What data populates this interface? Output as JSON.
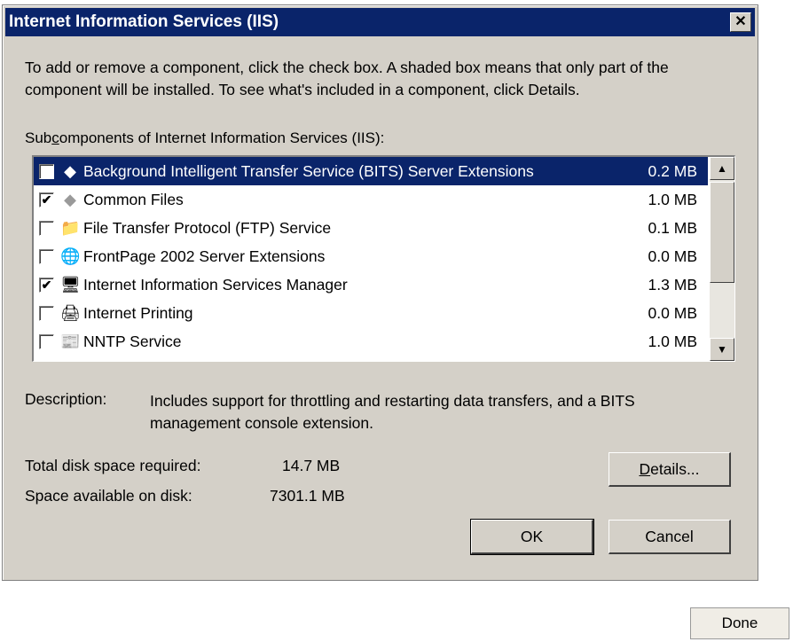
{
  "window": {
    "title": "Internet Information Services (IIS)",
    "close_label": "✕"
  },
  "intro_text": "To add or remove a component, click the check box. A shaded box means that only part of the component will be installed. To see what's included in a component, click Details.",
  "subcomponents_label": {
    "before": "Sub",
    "underlined": "c",
    "after": "omponents of Internet Information Services (IIS):"
  },
  "components": [
    {
      "name": "Background Intelligent Transfer Service (BITS) Server Extensions",
      "size": "0.2 MB",
      "checked": false,
      "selected": true,
      "icon": "diamond-icon"
    },
    {
      "name": "Common Files",
      "size": "1.0 MB",
      "checked": true,
      "selected": false,
      "icon": "diamond-icon"
    },
    {
      "name": "File Transfer Protocol (FTP) Service",
      "size": "0.1 MB",
      "checked": false,
      "selected": false,
      "icon": "folder-icon"
    },
    {
      "name": "FrontPage 2002 Server Extensions",
      "size": "0.0 MB",
      "checked": false,
      "selected": false,
      "icon": "frontpage-icon"
    },
    {
      "name": "Internet Information Services Manager",
      "size": "1.3 MB",
      "checked": true,
      "selected": false,
      "icon": "server-manager-icon"
    },
    {
      "name": "Internet Printing",
      "size": "0.0 MB",
      "checked": false,
      "selected": false,
      "icon": "printer-icon"
    },
    {
      "name": "NNTP Service",
      "size": "1.0 MB",
      "checked": false,
      "selected": false,
      "icon": "nntp-icon"
    }
  ],
  "description": {
    "label": "Description:",
    "text": "Includes support for throttling and restarting data transfers, and a BITS management console extension."
  },
  "disk": {
    "required_label": "Total disk space required:",
    "required_value": "14.7 MB",
    "available_label": "Space available on disk:",
    "available_value": "7301.1 MB"
  },
  "buttons": {
    "details_prefix": "D",
    "details_rest": "etails...",
    "ok": "OK",
    "cancel": "Cancel",
    "done": "Done"
  }
}
